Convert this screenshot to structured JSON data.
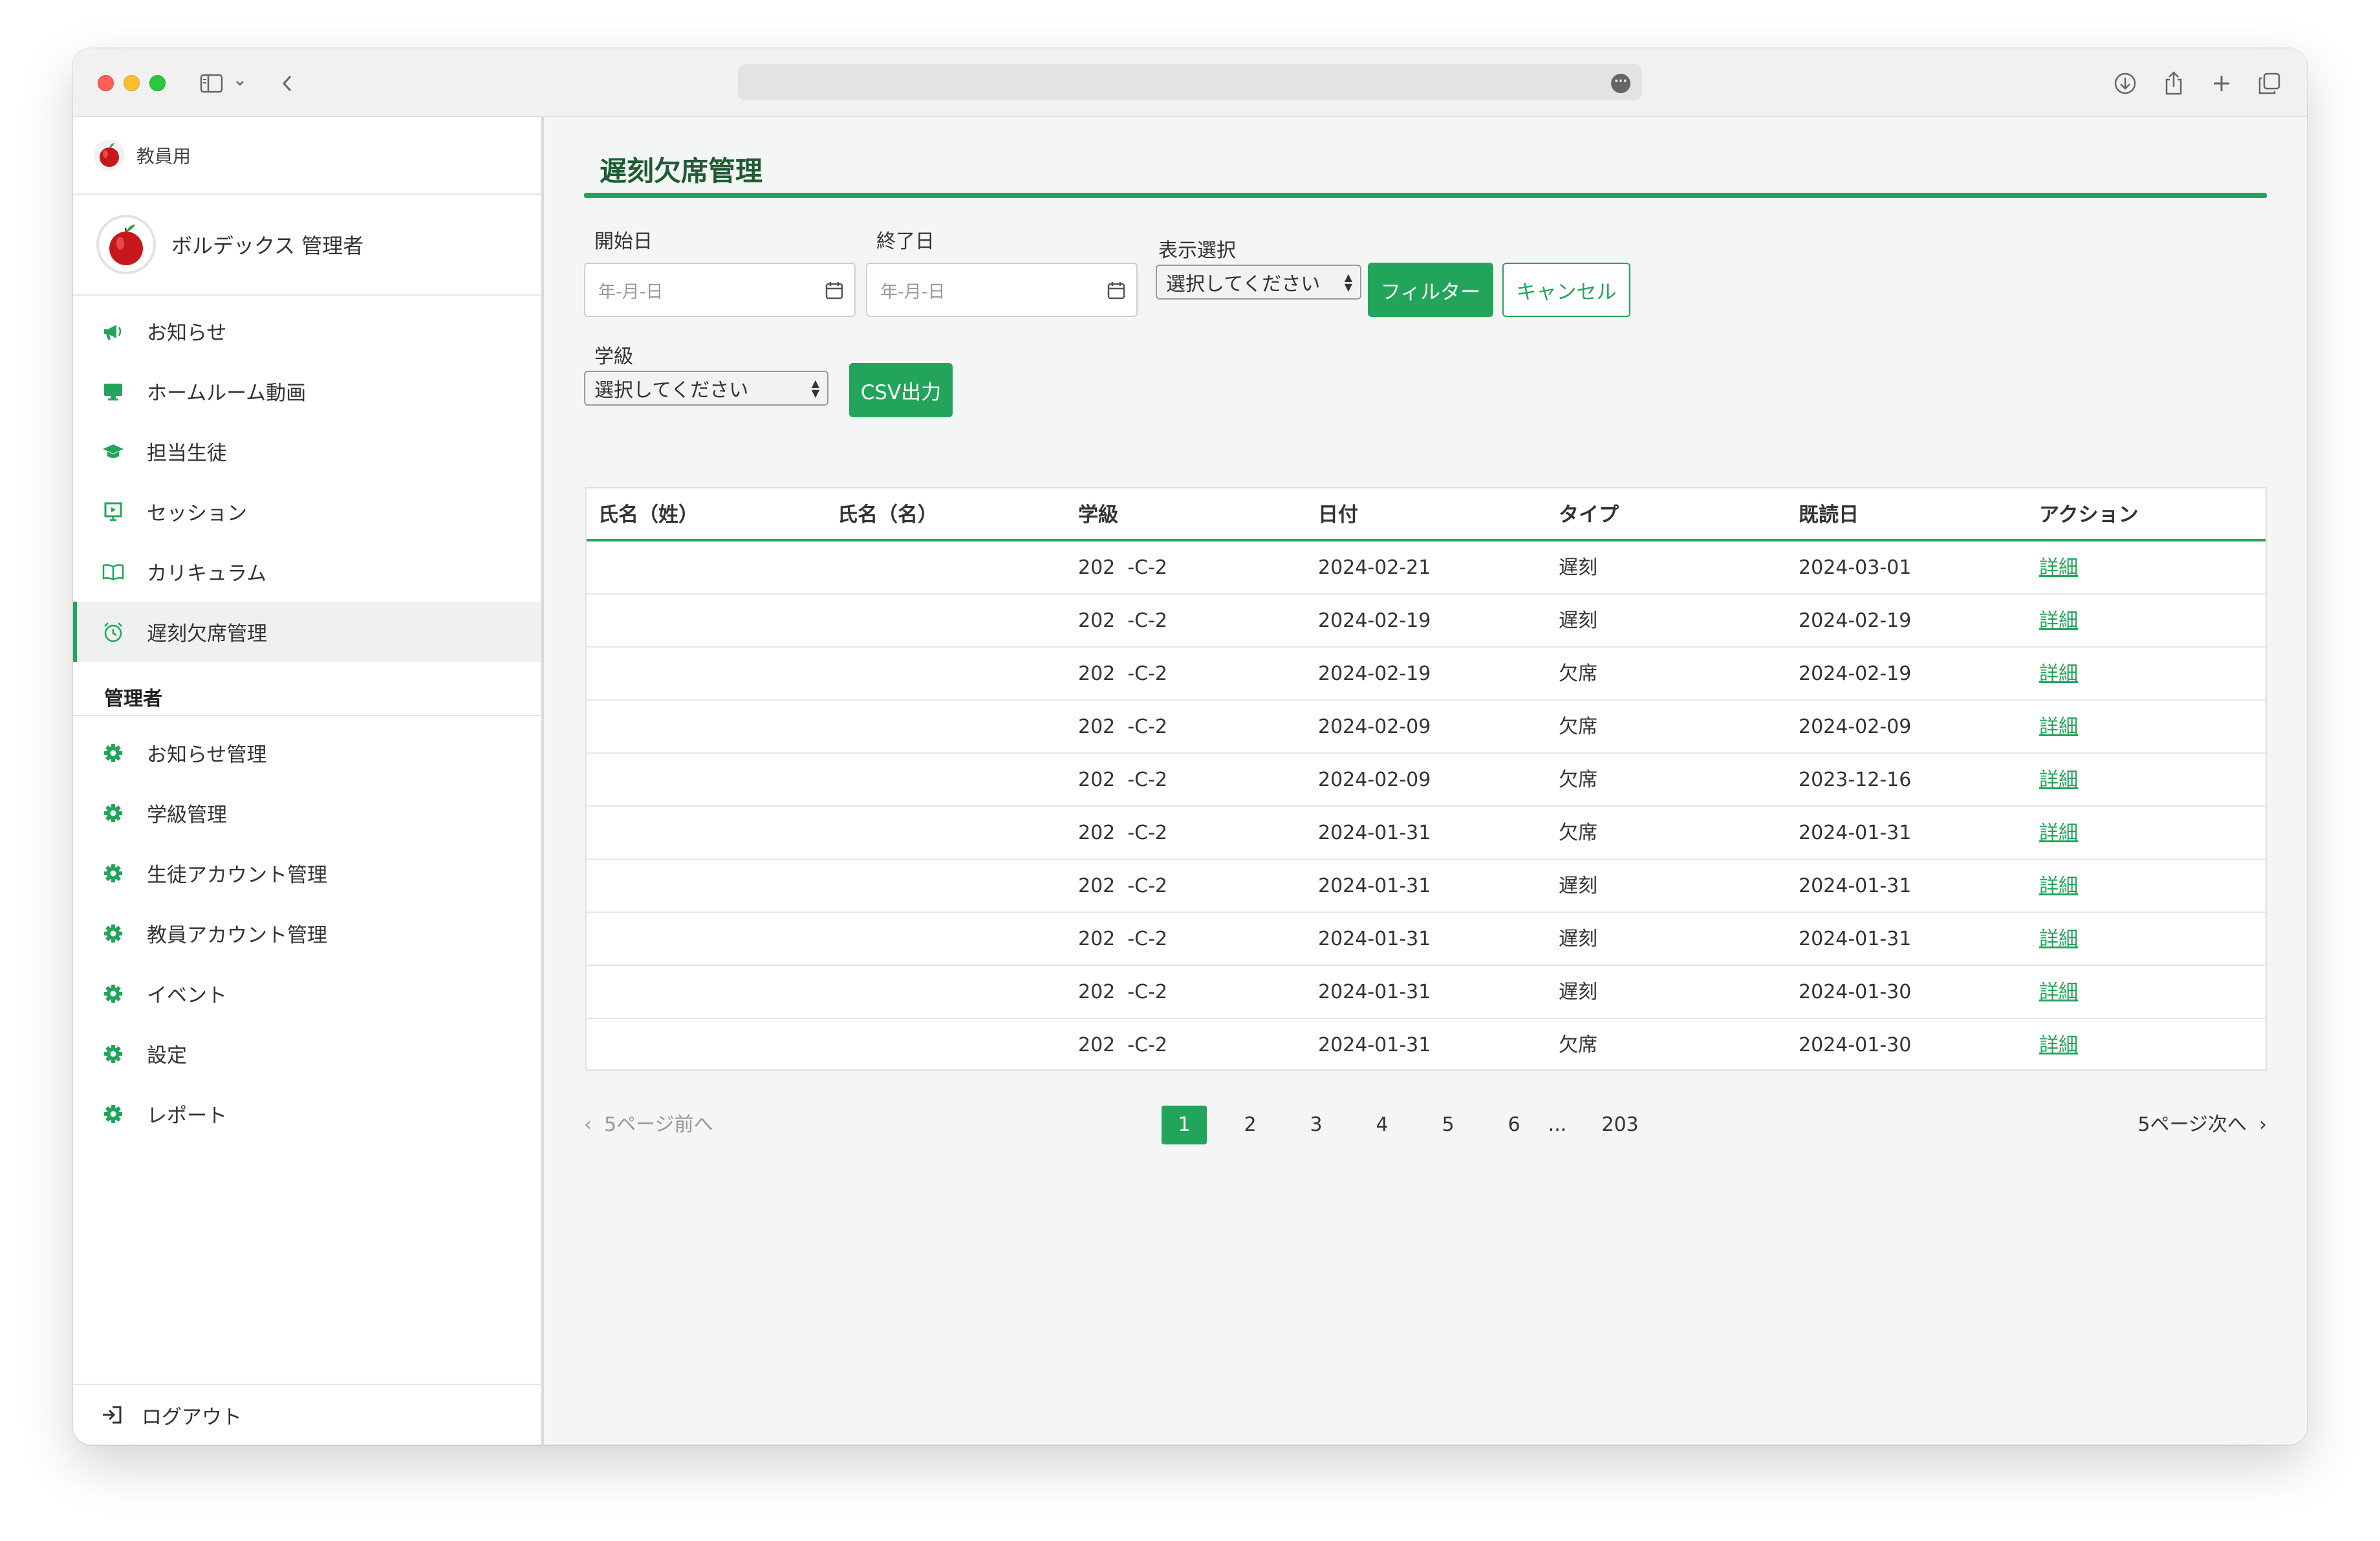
{
  "sidebar": {
    "brand_label": "教員用",
    "user_name": "ボルデックス 管理者",
    "items": [
      {
        "label": "お知らせ",
        "icon": "megaphone-icon"
      },
      {
        "label": "ホームルーム動画",
        "icon": "monitor-icon"
      },
      {
        "label": "担当生徒",
        "icon": "graduation-cap-icon"
      },
      {
        "label": "セッション",
        "icon": "presentation-icon"
      },
      {
        "label": "カリキュラム",
        "icon": "book-icon"
      },
      {
        "label": "遅刻欠席管理",
        "icon": "alarm-clock-icon",
        "active": true
      }
    ],
    "admin_title": "管理者",
    "admin_items": [
      {
        "label": "お知らせ管理",
        "icon": "gear-icon"
      },
      {
        "label": "学級管理",
        "icon": "gear-icon"
      },
      {
        "label": "生徒アカウント管理",
        "icon": "gear-icon"
      },
      {
        "label": "教員アカウント管理",
        "icon": "gear-icon"
      },
      {
        "label": "イベント",
        "icon": "gear-icon"
      },
      {
        "label": "設定",
        "icon": "gear-icon"
      },
      {
        "label": "レポート",
        "icon": "gear-icon"
      }
    ],
    "logout_label": "ログアウト"
  },
  "main": {
    "title": "遅刻欠席管理",
    "filters": {
      "start_label": "開始日",
      "start_placeholder": "年-月-日",
      "end_label": "終了日",
      "end_placeholder": "年-月-日",
      "display_label": "表示選択",
      "display_value": "選択してください",
      "filter_button": "フィルター",
      "cancel_button": "キャンセル",
      "class_label": "学級",
      "class_value": "選択してください",
      "csv_button": "CSV出力"
    },
    "table": {
      "headers": [
        "氏名（姓）",
        "氏名（名）",
        "学級",
        "日付",
        "タイプ",
        "既読日",
        "アクション"
      ],
      "rows": [
        {
          "last": "",
          "first": "",
          "class": "202  -C-2",
          "date": "2024-02-21",
          "type": "遅刻",
          "read": "2024-03-01",
          "action": "詳細"
        },
        {
          "last": "",
          "first": "",
          "class": "202  -C-2",
          "date": "2024-02-19",
          "type": "遅刻",
          "read": "2024-02-19",
          "action": "詳細"
        },
        {
          "last": "",
          "first": "",
          "class": "202  -C-2",
          "date": "2024-02-19",
          "type": "欠席",
          "read": "2024-02-19",
          "action": "詳細"
        },
        {
          "last": "",
          "first": "",
          "class": "202  -C-2",
          "date": "2024-02-09",
          "type": "欠席",
          "read": "2024-02-09",
          "action": "詳細"
        },
        {
          "last": "",
          "first": "",
          "class": "202  -C-2",
          "date": "2024-02-09",
          "type": "欠席",
          "read": "2023-12-16",
          "action": "詳細"
        },
        {
          "last": "",
          "first": "",
          "class": "202  -C-2",
          "date": "2024-01-31",
          "type": "欠席",
          "read": "2024-01-31",
          "action": "詳細"
        },
        {
          "last": "",
          "first": "",
          "class": "202  -C-2",
          "date": "2024-01-31",
          "type": "遅刻",
          "read": "2024-01-31",
          "action": "詳細"
        },
        {
          "last": "",
          "first": "",
          "class": "202  -C-2",
          "date": "2024-01-31",
          "type": "遅刻",
          "read": "2024-01-31",
          "action": "詳細"
        },
        {
          "last": "",
          "first": "",
          "class": "202  -C-2",
          "date": "2024-01-31",
          "type": "遅刻",
          "read": "2024-01-30",
          "action": "詳細"
        },
        {
          "last": "",
          "first": "",
          "class": "202  -C-2",
          "date": "2024-01-31",
          "type": "欠席",
          "read": "2024-01-30",
          "action": "詳細"
        }
      ]
    },
    "pagination": {
      "prev_label": "5ページ前へ",
      "next_label": "5ページ次へ",
      "pages": [
        "1",
        "2",
        "3",
        "4",
        "5",
        "6",
        "...",
        "203"
      ],
      "current": "1"
    }
  },
  "colors": {
    "accent": "#22a55b",
    "title": "#1e5b34"
  }
}
